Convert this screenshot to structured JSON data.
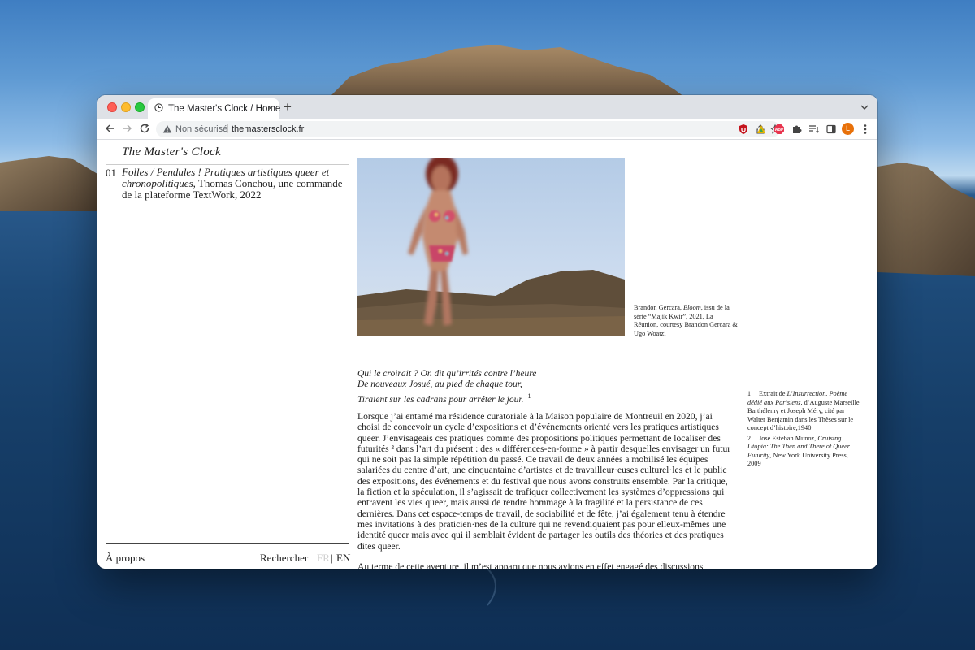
{
  "browser": {
    "tab": {
      "title": "The Master's Clock / Home",
      "close_label": "×"
    },
    "new_tab_label": "+",
    "address_bar": {
      "security_label": "Non sécurisé",
      "separator": "|",
      "url": "themastersclock.fr"
    },
    "profile_initial": "L",
    "extensions": [
      "ublock-icon",
      "light-icon",
      "abp-icon",
      "puzzle-icon",
      "reading-list-icon",
      "side-panel-icon"
    ]
  },
  "sidebar": {
    "site_title": "The Master's Clock",
    "entries": [
      {
        "number": "01",
        "title": "Folles / Pendules ! Pratiques artistiques queer et chronopolitiques",
        "details": ", Thomas Conchou, une commande de la plateforme TextWork, 2022"
      }
    ],
    "footer": {
      "about": "À propos",
      "search": "Rechercher",
      "lang_fr": "FR",
      "lang_sep": "|",
      "lang_en": "EN"
    }
  },
  "article": {
    "caption": {
      "prefix": "Brandon Gercara, ",
      "work": "Bloom",
      "rest": ", issu de la série “Majik Kwir”, 2021, La Réunion, courtesy Brandon Gercara & Ugo Woatzi"
    },
    "poem": [
      "Qui le croirait ? On dit qu’irrités contre l’heure",
      "De nouveaux Josué, au pied de chaque tour,",
      "Tiraient sur les cadrans pour arrêter le jour."
    ],
    "poem_note": "1",
    "paragraphs": [
      "Lorsque j’ai entamé ma résidence curatoriale à la Maison populaire de Montreuil en 2020, j’ai choisi de concevoir un cycle d’expositions et d’événements orienté vers les pratiques artistiques queer. J’envisageais ces pratiques comme des propositions politiques permettant de localiser des futurités ² dans l’art du présent : des « différences-en-forme » à partir desquelles envisager un futur qui ne soit pas la simple répétition du passé. Ce travail de deux années a mobilisé les équipes salariées du centre d’art, une cinquantaine d’artistes et de travailleur·euses culturel·les et le public des expositions, des événements et du festival que nous avons construits ensemble. Par la critique, la fiction et la spéculation, il s’agissait de trafiquer collectivement les systèmes d’oppressions qui entravent les vies queer, mais aussi de rendre hommage à la fragilité et la persistance de ces dernières. Dans cet espace-temps de travail, de sociabilité et de fête, j’ai également tenu à étendre mes invitations à des praticien·nes de la culture qui ne revendiquaient pas pour elleux-mêmes une identité queer mais avec qui il semblait évident de partager les outils des théories et des pratiques dites queer.",
      "Au terme de cette aventure, il m’est apparu que nous avions en effet engagé des discussions"
    ]
  },
  "footnotes": [
    {
      "num": "1",
      "pre": "Extrait de ",
      "em": "L’Insurrection. Poème dédié aux Parisiens",
      "post": ", d’Auguste Marseille Barthélemy et Joseph Méry, cité par Walter Benjamin dans les Thèses sur le concept d’histoire,1940"
    },
    {
      "num": "2",
      "pre": "José Esteban Munoz, ",
      "em": "Cruising Utopia: The Then and There of Queer Futurity",
      "post": ", New York University Press, 2009"
    }
  ],
  "colors": {
    "accent": "#e8710a",
    "text": "#222222",
    "lang_inactive": "#cfcfcf"
  }
}
